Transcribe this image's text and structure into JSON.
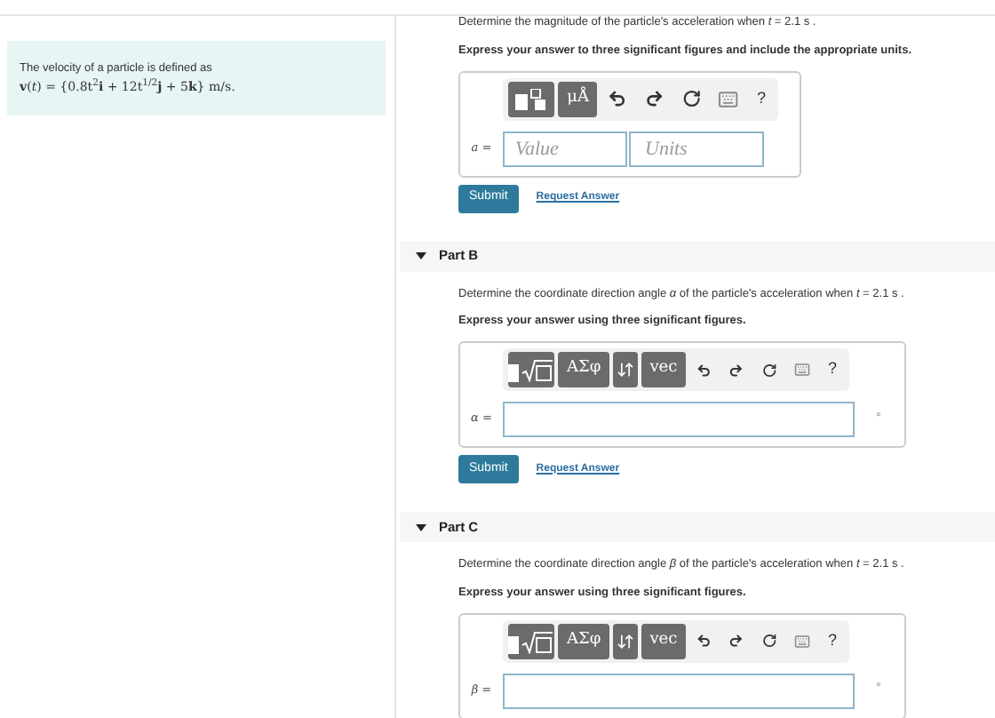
{
  "problem": {
    "intro": "The velocity of a particle is defined as",
    "formula": "**v**(*t*) = {0.8t$^{2}$**i** + 12t$^{1/2}$**j** + 5**k**} m/s."
  },
  "parts": [
    {
      "prompt": "Determine the magnitude of the particle's acceleration when *t* = 2.1  s .",
      "instruction": "Express your answer to three significant figures and include the appropriate units.",
      "toolbar": [
        {
          "kind": "template"
        },
        {
          "kind": "text",
          "label": "μÅ"
        },
        {
          "kind": "undo"
        },
        {
          "kind": "redo"
        },
        {
          "kind": "reset"
        },
        {
          "kind": "keyboard"
        },
        {
          "kind": "text-plain",
          "label": "?"
        }
      ],
      "variable": "a =",
      "input": {
        "kind": "value_units",
        "value_placeholder": "Value",
        "units_placeholder": "Units"
      },
      "submit": "Submit",
      "request": "Request Answer"
    },
    {
      "title": "Part B",
      "expanded": true,
      "prompt": "Determine the coordinate direction angle *α* of the particle's acceleration when *t* = 2.1  s .",
      "instruction": "Express your answer using three significant figures.",
      "toolbar": [
        {
          "kind": "radical"
        },
        {
          "kind": "text",
          "label": "ΑΣφ"
        },
        {
          "kind": "arrows"
        },
        {
          "kind": "text",
          "label": "vec"
        },
        {
          "kind": "undo"
        },
        {
          "kind": "redo"
        },
        {
          "kind": "reset"
        },
        {
          "kind": "keyboard"
        },
        {
          "kind": "text-plain",
          "label": "?"
        }
      ],
      "variable": "α =",
      "input": {
        "kind": "single",
        "suffix": "°"
      },
      "submit": "Submit",
      "request": "Request Answer"
    },
    {
      "title": "Part C",
      "expanded": true,
      "prompt": "Determine the coordinate direction angle *β* of the particle's acceleration when *t* = 2.1  s .",
      "instruction": "Express your answer using three significant figures.",
      "toolbar": [
        {
          "kind": "radical"
        },
        {
          "kind": "text",
          "label": "ΑΣφ"
        },
        {
          "kind": "arrows"
        },
        {
          "kind": "text",
          "label": "vec"
        },
        {
          "kind": "undo"
        },
        {
          "kind": "redo"
        },
        {
          "kind": "reset"
        },
        {
          "kind": "keyboard"
        },
        {
          "kind": "text-plain",
          "label": "?"
        }
      ],
      "variable": "β =",
      "input": {
        "kind": "single",
        "suffix": "°"
      }
    }
  ]
}
